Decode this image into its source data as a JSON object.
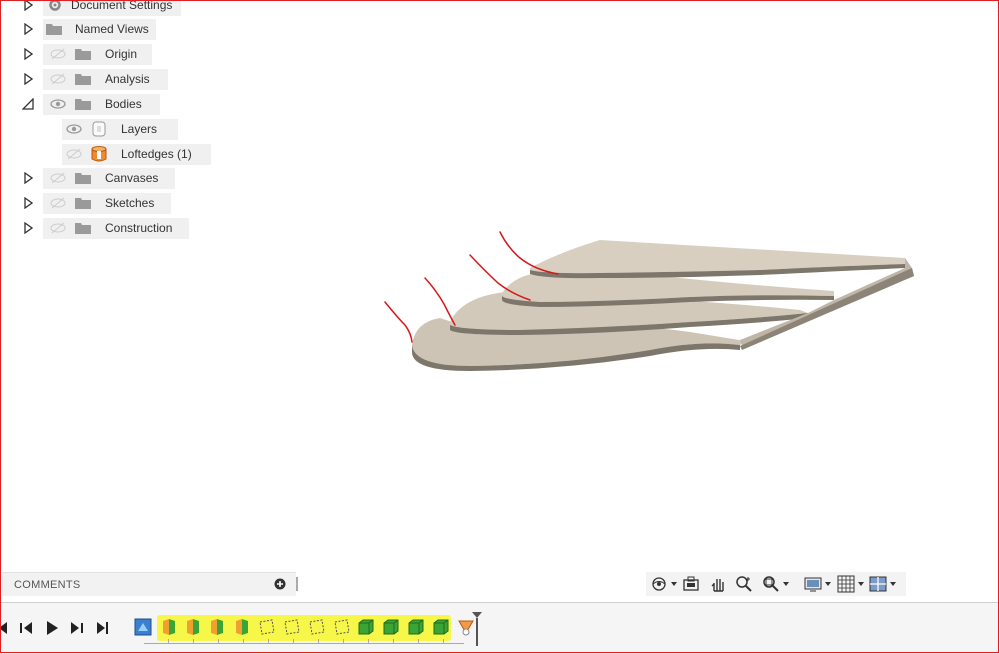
{
  "browser": {
    "items": [
      {
        "label": "Document Settings",
        "icon": "gear-icon"
      },
      {
        "label": "Named Views",
        "icon": "folder-icon"
      },
      {
        "label": "Origin",
        "icon": "folder-icon"
      },
      {
        "label": "Analysis",
        "icon": "folder-icon"
      },
      {
        "label": "Bodies",
        "icon": "folder-icon"
      },
      {
        "label": "Layers",
        "icon": "layer-icon"
      },
      {
        "label": "Loftedges (1)",
        "icon": "body-icon"
      },
      {
        "label": "Canvases",
        "icon": "folder-icon"
      },
      {
        "label": "Sketches",
        "icon": "folder-icon"
      },
      {
        "label": "Construction",
        "icon": "folder-icon"
      }
    ]
  },
  "comments": {
    "title": "COMMENTS"
  },
  "colors": {
    "body": "#cfc6b8",
    "body_edge": "#8e8679",
    "annotation": "#d81818",
    "highlight": "#f7f74a",
    "frame": "#e02020"
  },
  "nav_toolbar": [
    "orbit-icon",
    "look-at-icon",
    "pan-icon",
    "zoom-icon",
    "fit-icon",
    "display-settings-icon",
    "grid-icon",
    "viewports-icon"
  ],
  "timeline": {
    "controls": [
      "go-to-start-icon",
      "step-back-icon",
      "play-icon",
      "step-forward-icon",
      "go-to-end-icon"
    ],
    "features": [
      "sketch-icon",
      "loft-icon",
      "loft-icon",
      "loft-icon",
      "loft-icon",
      "plane-icon",
      "plane-icon",
      "plane-icon",
      "plane-icon",
      "extrude-icon",
      "extrude-icon",
      "extrude-icon",
      "extrude-icon",
      "body-icon"
    ]
  }
}
